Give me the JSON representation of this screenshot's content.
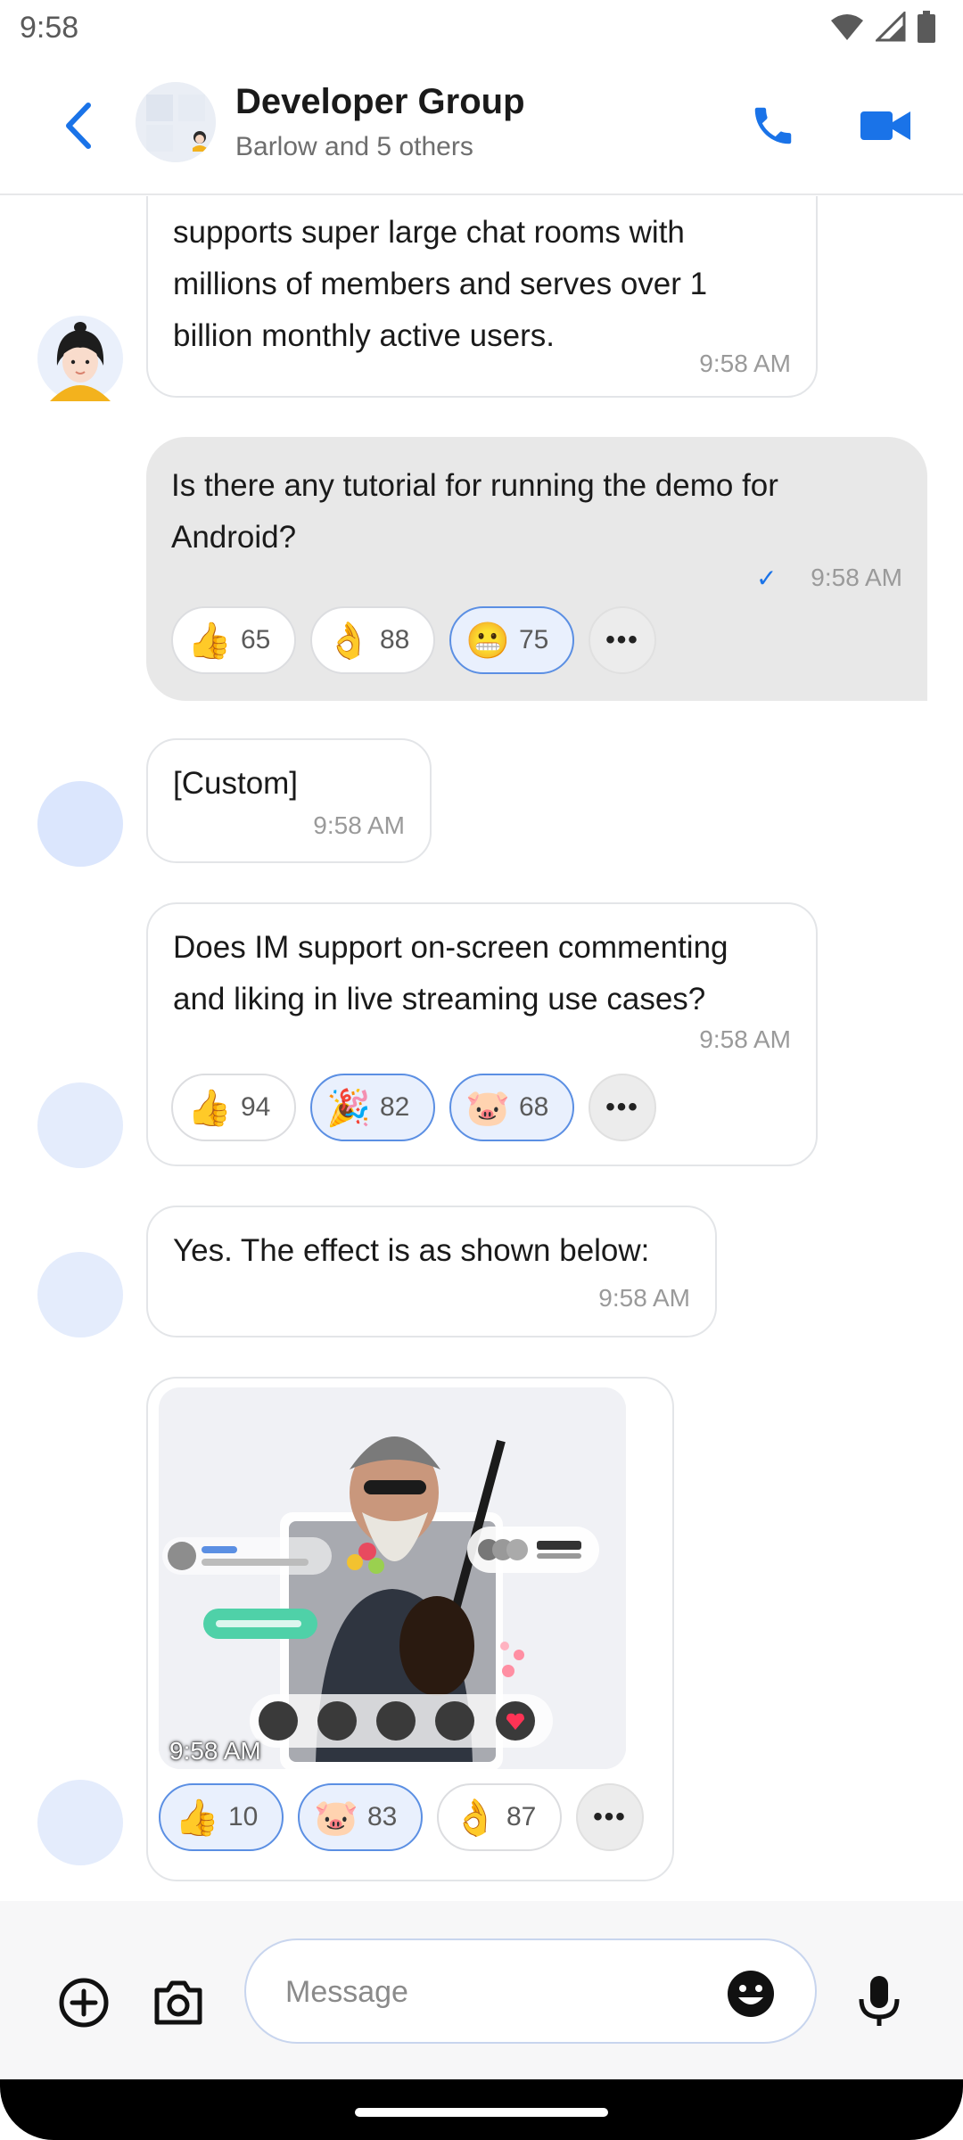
{
  "status_bar": {
    "time": "9:58"
  },
  "header": {
    "title": "Developer Group",
    "subtitle": "Barlow and 5 others"
  },
  "messages": [
    {
      "text_lines": [
        "supports super large chat rooms with",
        "millions of members and serves over 1",
        "billion monthly active users."
      ],
      "time": "9:58 AM"
    },
    {
      "text_lines": [
        "Is there any tutorial for running the demo for",
        "Android?"
      ],
      "time": "9:58 AM",
      "reactions": [
        {
          "icon": "thumbs-up-emoji",
          "count": "65"
        },
        {
          "icon": "ok-hand-emoji",
          "count": "88"
        },
        {
          "icon": "grimace-emoji",
          "count": "75"
        }
      ]
    },
    {
      "text_lines": [
        "[Custom]"
      ],
      "time": "9:58 AM"
    },
    {
      "text_lines": [
        "Does IM support on-screen commenting",
        "and liking in live streaming use cases?"
      ],
      "time": "9:58 AM",
      "reactions": [
        {
          "icon": "thumbs-up-emoji",
          "count": "94"
        },
        {
          "icon": "party-popper-emoji",
          "count": "82"
        },
        {
          "icon": "pig-emoji",
          "count": "68"
        }
      ]
    },
    {
      "text_lines": [
        "Yes. The effect is as shown below:"
      ],
      "time": "9:58 AM"
    },
    {
      "image": "live-stream-screenshot",
      "time": "9:58 AM",
      "reactions": [
        {
          "icon": "thumbs-up-emoji",
          "count": "10"
        },
        {
          "icon": "pig-emoji",
          "count": "83"
        },
        {
          "icon": "ok-hand-emoji",
          "count": "87"
        }
      ]
    }
  ],
  "composer": {
    "placeholder": "Message"
  },
  "colors": {
    "accent": "#1a73e8",
    "bubble_self": "#e8e8e8",
    "chip_active": "#e9f0fd"
  }
}
